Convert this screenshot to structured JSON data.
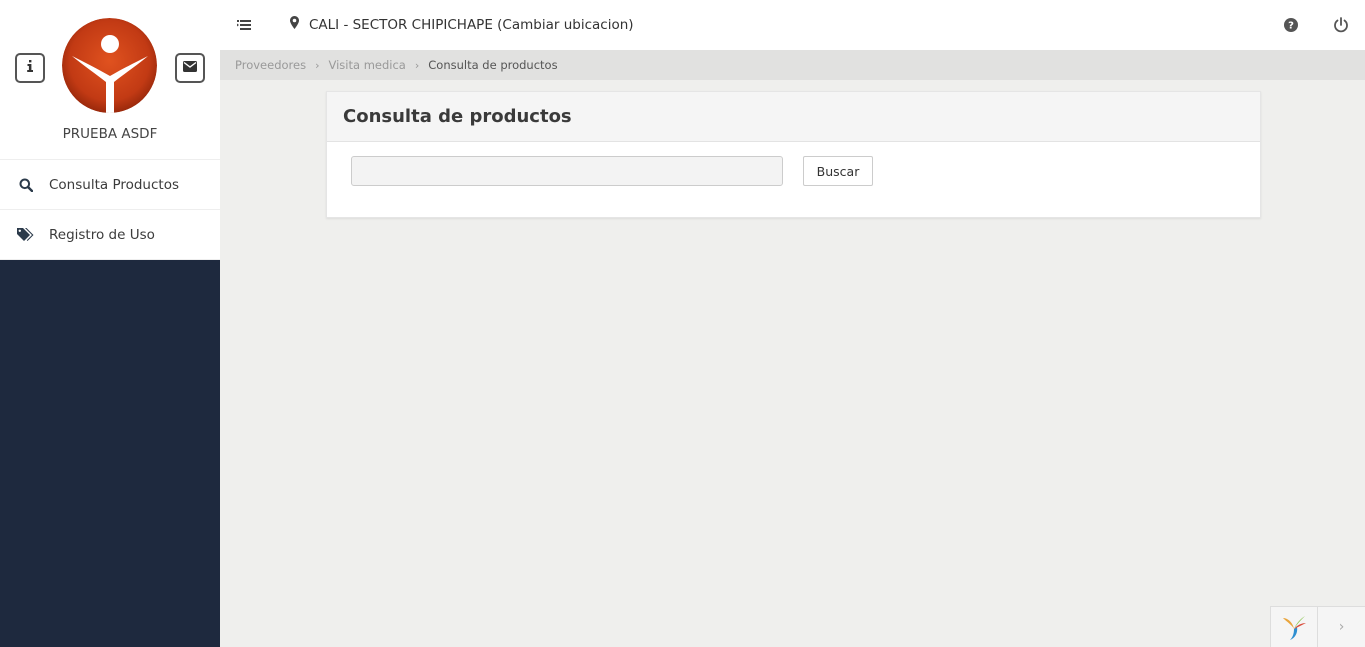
{
  "sidebar": {
    "user_name": "PRUEBA ASDF",
    "items": [
      {
        "label": "Consulta Productos",
        "icon": "search-icon"
      },
      {
        "label": "Registro de Uso",
        "icon": "tags-icon"
      }
    ],
    "bg_color": "#1e293e"
  },
  "topbar": {
    "location": "CALI - SECTOR CHIPICHAPE (Cambiar ubicacion)"
  },
  "breadcrumb": {
    "items": [
      "Proveedores",
      "Visita medica",
      "Consulta de productos"
    ]
  },
  "panel": {
    "title": "Consulta de productos",
    "search_value": "",
    "search_button": "Buscar"
  },
  "colors": {
    "logo": "#c8401a",
    "sidebar": "#1e293e"
  }
}
